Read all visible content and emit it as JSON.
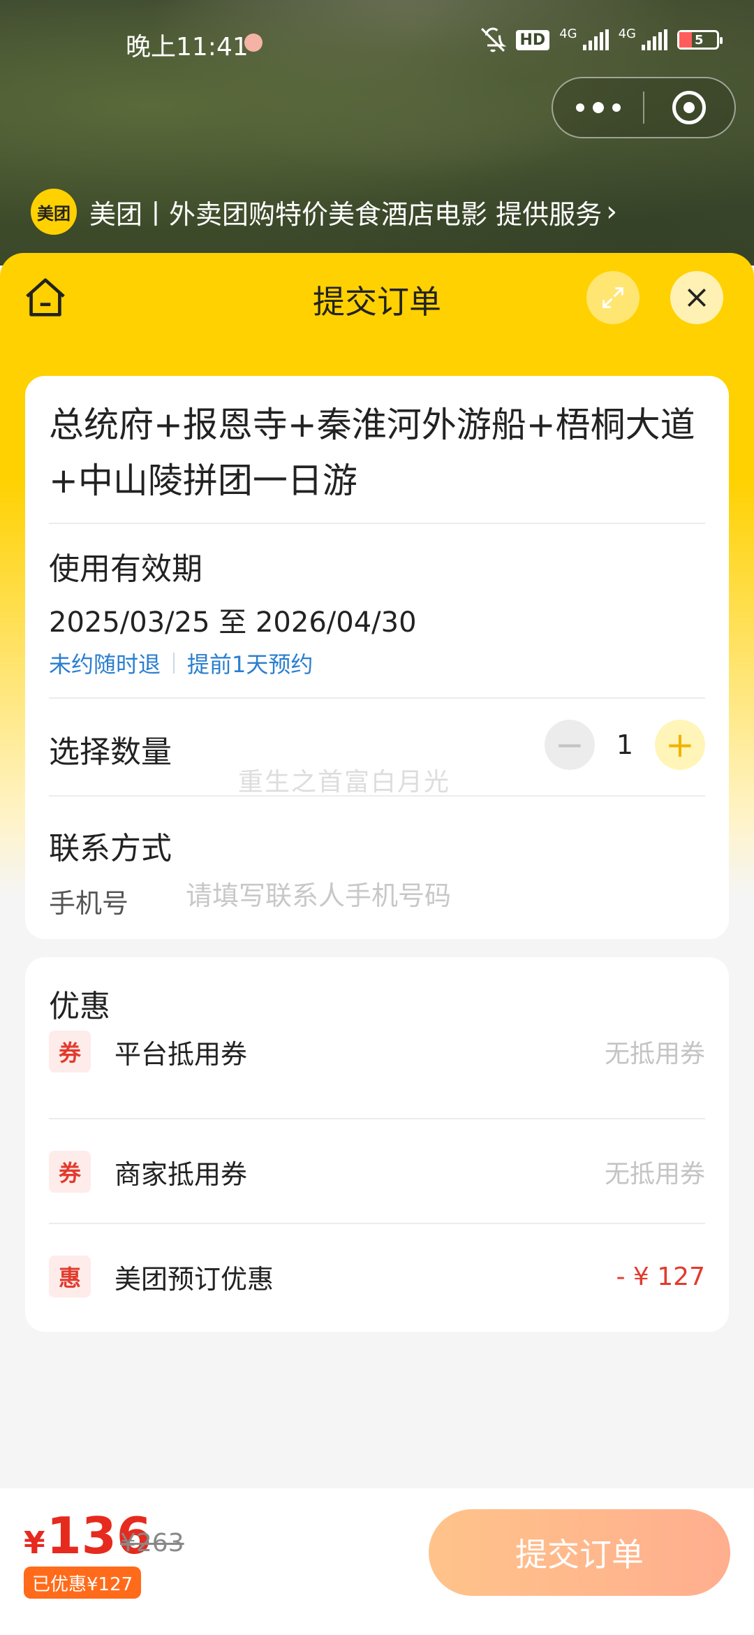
{
  "status_bar": {
    "time": "晚上11:41",
    "hd_label": "HD",
    "net1": "4G",
    "net2": "4G",
    "battery_level": "5",
    "icons": [
      "notification-icon",
      "bell-off-icon",
      "signal-icon",
      "battery-icon"
    ]
  },
  "capsule": {
    "more_icon": "more-dots-icon",
    "target_icon": "target-icon"
  },
  "provider": {
    "logo_text": "美团",
    "text": "美团丨外卖团购特价美食酒店电影 提供服务",
    "chevron": "›"
  },
  "nav": {
    "title": "提交订单",
    "home_icon": "home-icon",
    "expand_icon": "expand-icon",
    "close_icon": "close-icon"
  },
  "product": {
    "title": "总统府+报恩寺+秦淮河外游船+梧桐大道+中山陵拼团一日游",
    "validity_label": "使用有效期",
    "validity_dates": "2025/03/25 至 2026/04/30",
    "policies": [
      "未约随时退",
      "提前1天预约"
    ]
  },
  "quantity": {
    "label": "选择数量",
    "value": "1",
    "minus": "−",
    "plus": "+"
  },
  "watermark": "重生之首富白月光",
  "contact": {
    "label": "联系方式",
    "phone_label": "手机号",
    "phone_placeholder": "请填写联系人手机号码",
    "phone_value": ""
  },
  "promotions": {
    "title": "优惠",
    "items": [
      {
        "icon_text": "券",
        "label": "平台抵用券",
        "value": "无抵用券"
      },
      {
        "icon_text": "券",
        "label": "商家抵用券",
        "value": "无抵用券"
      },
      {
        "icon_text": "惠",
        "label": "美团预订优惠",
        "value": "- ¥ 127"
      }
    ]
  },
  "footer": {
    "currency": "¥",
    "price": "136",
    "original_price": "¥263",
    "saved": "已优惠¥127",
    "submit_label": "提交订单"
  },
  "colors": {
    "brand_yellow": "#ffd100",
    "price_red": "#e62a1e",
    "link_blue": "#2a7ed0",
    "submit_gradient_start": "#ffc38a",
    "submit_gradient_end": "#ffae8e"
  }
}
